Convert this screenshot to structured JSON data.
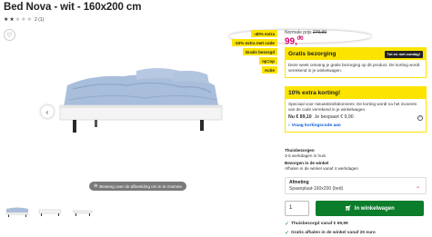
{
  "product": {
    "title": "Bed Nova - wit - 160x200 cm",
    "rating_stars_filled": 2,
    "rating_stars_total": 5,
    "rating_count": "2 (1)"
  },
  "gallery": {
    "zoom_hint": "Beweeg over de afbeelding om in te zoomen",
    "thumbnail_count": 3
  },
  "tags": [
    "-40% extra",
    "-10% extra met code",
    "Gratis bezorgd",
    "op=op",
    "Actie"
  ],
  "pricing": {
    "normal_label": "Normale prijs",
    "normal_price": "279,00",
    "price_main": "99,",
    "price_cents": "00",
    "accent_color": "#e0006c"
  },
  "promo": {
    "heading": "Gratis bezorging",
    "badge": "Tot en met zondag!",
    "text": "Deze week ontvang je gratis bezorging op dit product. De korting wordt verrekend in je winkelwagen.",
    "color": "#fde400"
  },
  "discount": {
    "heading": "10% extra korting!",
    "text": "Speciaal voor nieuwsbriefabonnees: De korting wordt na het invoeren van de code verrekend in je winkelwagen.",
    "now_label": "Nu € 89,10",
    "save_label": "Je bespaart € 9,90",
    "link_label": "Vraag kortingscode aan"
  },
  "shipping": {
    "thuis_label": "Thuisbezorgen",
    "thuis_value": "3-5 werkdagen in huis",
    "pickup_label": "Bezorgen in de winkel",
    "pickup_value": "Afhalen in de winkel vanaf 4 werkdagen"
  },
  "variant": {
    "label": "Afmeting",
    "value": "Spaanplaat-160x200 (bed)"
  },
  "cart": {
    "quantity": "1",
    "button_label": "In winkelwagen",
    "color": "#0b7d2b"
  },
  "usps": [
    "Thuisbezorgd vanaf € 69,99",
    "Gratis afhalen in de winkel vanaf 20 euro"
  ]
}
